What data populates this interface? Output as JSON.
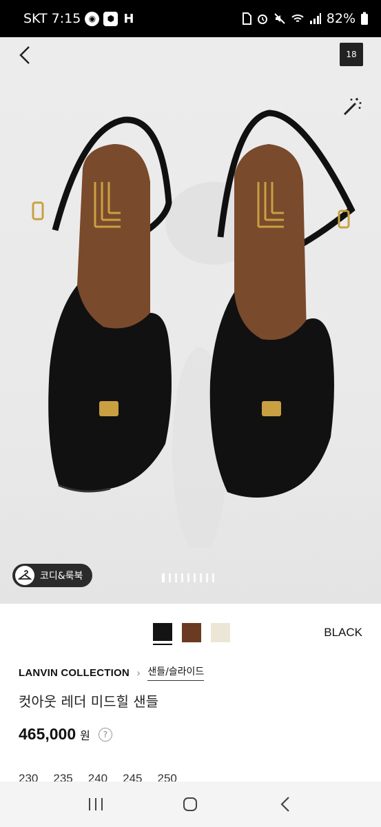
{
  "status_bar": {
    "carrier": "SKT",
    "time": "7:15",
    "app_letter": "H",
    "battery": "82%"
  },
  "hero": {
    "photo_count": "18",
    "codi_label": "코디&룩북",
    "page_indicator_count": 9
  },
  "product": {
    "swatches": [
      {
        "name": "black",
        "color": "#141414",
        "selected": true
      },
      {
        "name": "brown",
        "color": "#6b3a22",
        "selected": false
      },
      {
        "name": "cream",
        "color": "#ece6d6",
        "selected": false
      }
    ],
    "selected_color": "BLACK",
    "brand": "LANVIN COLLECTION",
    "category": "샌들/슬라이드",
    "name": "컷아웃 레더 미드힐 샌들",
    "price": "465,000",
    "currency": "원",
    "help": "?",
    "sizes": [
      "230",
      "235",
      "240",
      "245",
      "250"
    ]
  }
}
